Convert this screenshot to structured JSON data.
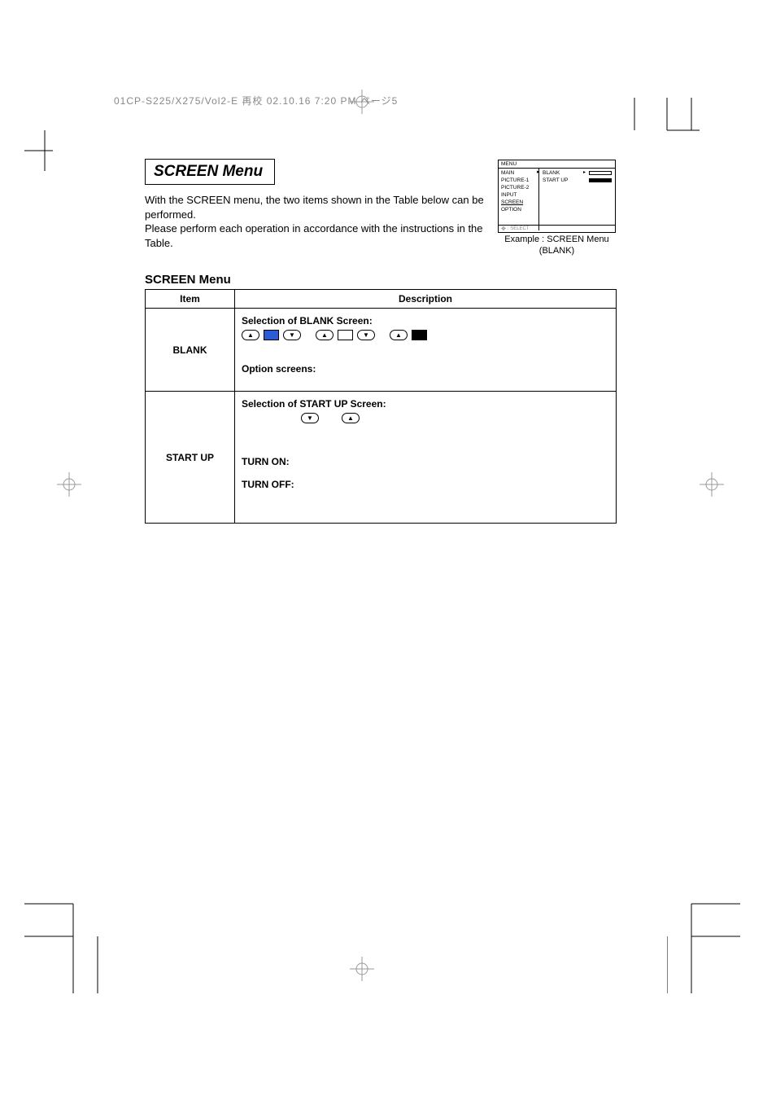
{
  "header_info": "01CP-S225/X275/Vol2-E  再校  02.10.16  7:20 PM  ページ5",
  "title": "SCREEN Menu",
  "intro_p1": "With the SCREEN menu, the two items shown in the Table below can be performed.",
  "intro_p2": "Please perform each operation in accordance with the instructions in the Table.",
  "osd": {
    "menu_header": "MENU",
    "left_items": [
      "MAIN",
      "PICTURE-1",
      "PICTURE-2",
      "INPUT",
      "SCREEN",
      "OPTION"
    ],
    "right_items": [
      "BLANK",
      "START UP"
    ],
    "select_label": ": SELECT",
    "caption_line1": "Example : SCREEN Menu",
    "caption_line2": "(BLANK)"
  },
  "subsection_title": "SCREEN Menu",
  "table": {
    "headers": {
      "item": "Item",
      "description": "Description"
    },
    "rows": [
      {
        "item": "BLANK",
        "desc_heading": "Selection of BLANK Screen:",
        "option_screens": "Option screens:"
      },
      {
        "item": "START UP",
        "desc_heading": "Selection of START UP Screen:",
        "turn_on": "TURN ON:",
        "turn_off": "TURN OFF:"
      }
    ]
  }
}
